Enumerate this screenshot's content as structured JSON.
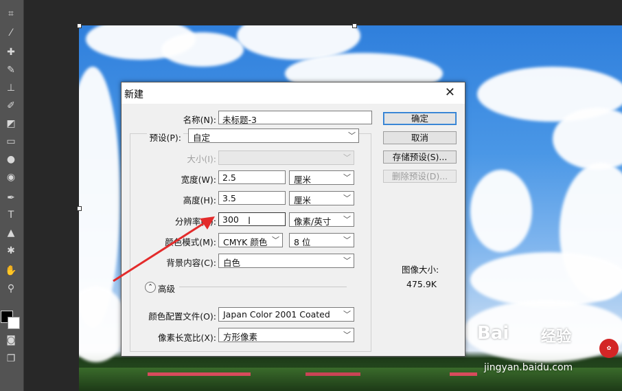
{
  "dialog": {
    "title": "新建",
    "name_label": "名称(N):",
    "name_value": "未标题-3",
    "preset_label": "预设(P):",
    "preset_value": "自定",
    "size_label": "大小(I):",
    "width_label": "宽度(W):",
    "width_value": "2.5",
    "width_unit": "厘米",
    "height_label": "高度(H):",
    "height_value": "3.5",
    "height_unit": "厘米",
    "resolution_label": "分辨率(R):",
    "resolution_value": "300",
    "resolution_unit": "像素/英寸",
    "color_mode_label": "颜色模式(M):",
    "color_mode_value": "CMYK 颜色",
    "bit_depth_value": "8 位",
    "background_label": "背景内容(C):",
    "background_value": "白色",
    "advanced_label": "高级",
    "color_profile_label": "颜色配置文件(O):",
    "color_profile_value": "Japan Color 2001 Coated",
    "pixel_aspect_label": "像素长宽比(X):",
    "pixel_aspect_value": "方形像素",
    "image_size_label": "图像大小:",
    "image_size_value": "475.9K",
    "buttons": {
      "ok": "确定",
      "cancel": "取消",
      "save_preset": "存储预设(S)...",
      "delete_preset": "删除预设(D)..."
    }
  },
  "watermark": {
    "brand": "Bai",
    "brand2": "经验",
    "url": "jingyan.baidu.com"
  },
  "colors": {
    "annotation_arrow": "#e32b2b",
    "default_button_border": "#2a7bd0"
  }
}
